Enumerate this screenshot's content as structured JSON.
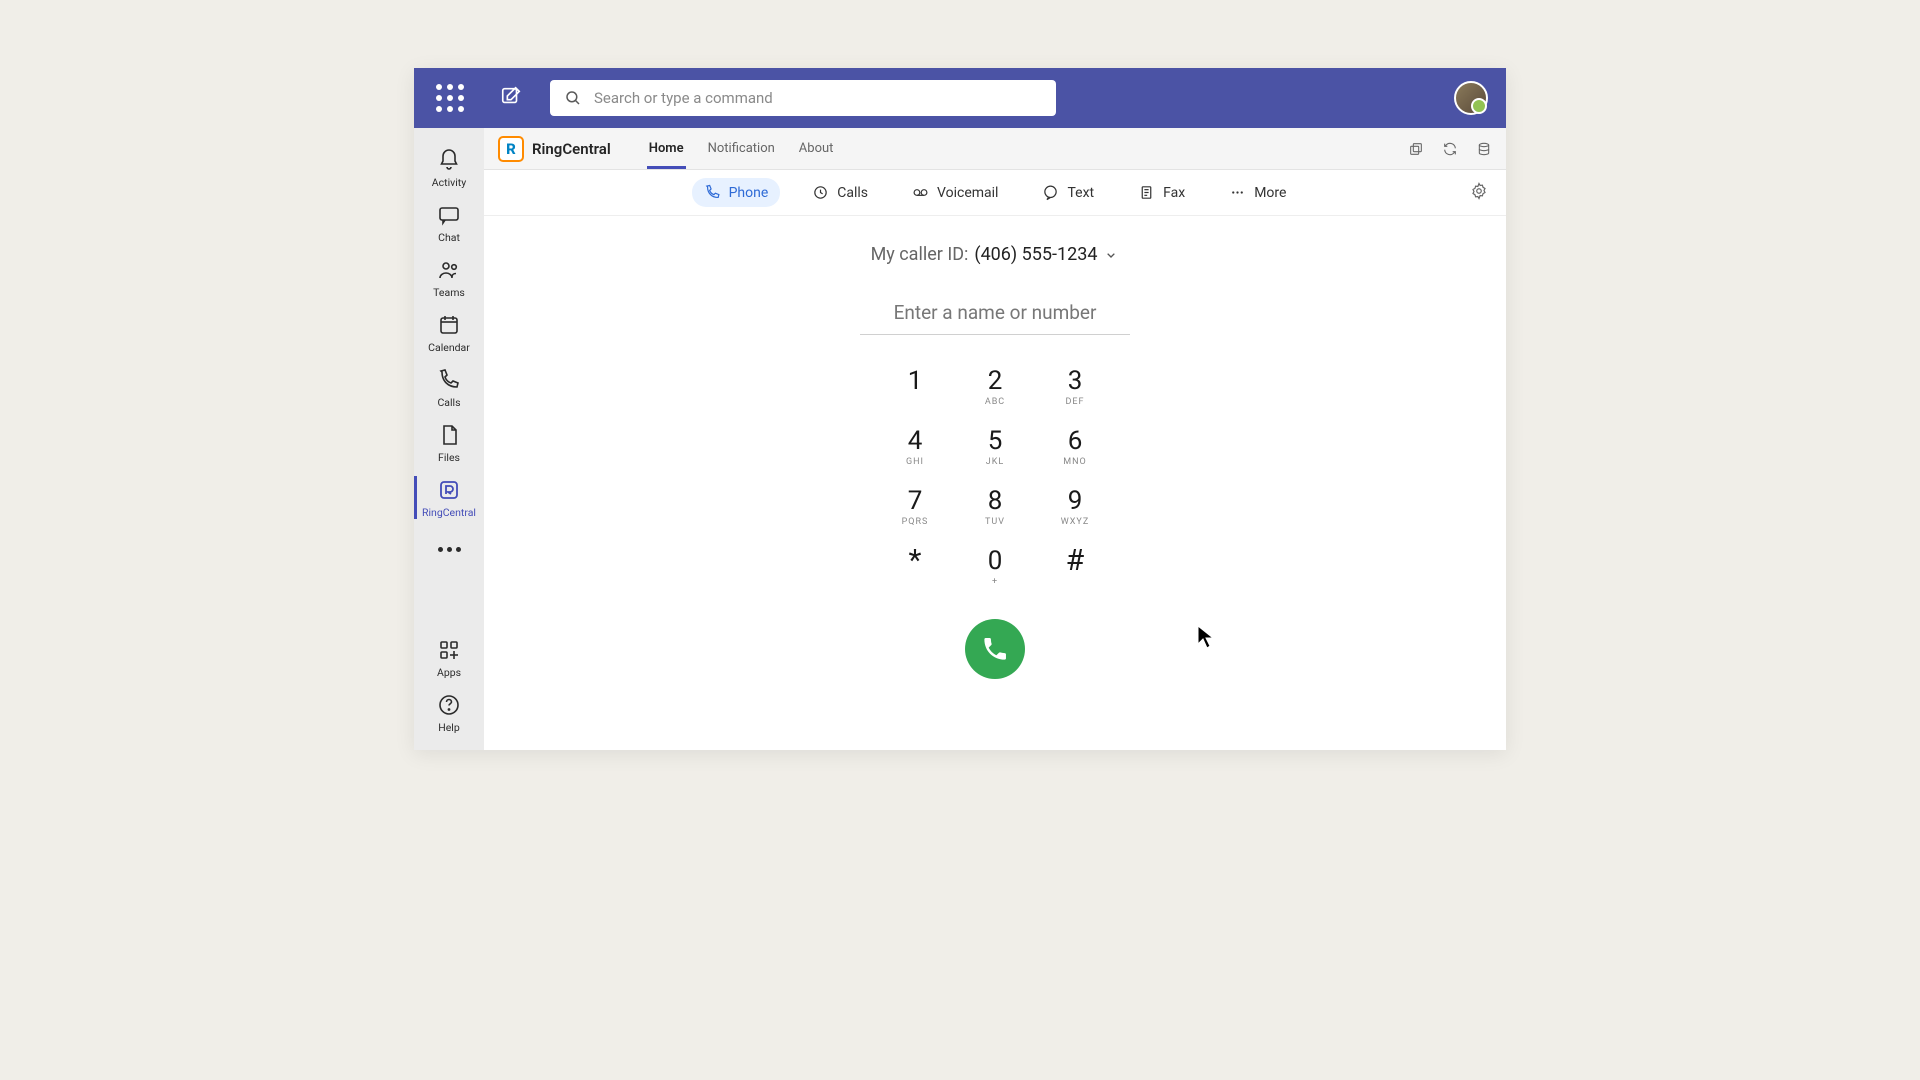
{
  "header": {
    "search_placeholder": "Search or type a command"
  },
  "left_rail": {
    "items": [
      {
        "label": "Activity"
      },
      {
        "label": "Chat"
      },
      {
        "label": "Teams"
      },
      {
        "label": "Calendar"
      },
      {
        "label": "Calls"
      },
      {
        "label": "Files"
      },
      {
        "label": "RingCentral"
      }
    ],
    "apps_label": "Apps",
    "help_label": "Help"
  },
  "app_header": {
    "brand_letter": "R",
    "brand_name": "RingCentral",
    "tabs": [
      {
        "label": "Home"
      },
      {
        "label": "Notification"
      },
      {
        "label": "About"
      }
    ]
  },
  "tool_row": {
    "items": [
      {
        "label": "Phone"
      },
      {
        "label": "Calls"
      },
      {
        "label": "Voicemail"
      },
      {
        "label": "Text"
      },
      {
        "label": "Fax"
      },
      {
        "label": "More"
      }
    ]
  },
  "dialer": {
    "caller_id_label": "My caller ID:",
    "caller_id_number": "(406) 555-1234",
    "input_placeholder": "Enter a name or number",
    "keys": [
      {
        "digit": "1",
        "sub": ""
      },
      {
        "digit": "2",
        "sub": "ABC"
      },
      {
        "digit": "3",
        "sub": "DEF"
      },
      {
        "digit": "4",
        "sub": "GHI"
      },
      {
        "digit": "5",
        "sub": "JKL"
      },
      {
        "digit": "6",
        "sub": "MNO"
      },
      {
        "digit": "7",
        "sub": "PQRS"
      },
      {
        "digit": "8",
        "sub": "TUV"
      },
      {
        "digit": "9",
        "sub": "WXYZ"
      },
      {
        "digit": "*",
        "sub": ""
      },
      {
        "digit": "0",
        "sub": "+"
      },
      {
        "digit": "#",
        "sub": ""
      }
    ]
  }
}
